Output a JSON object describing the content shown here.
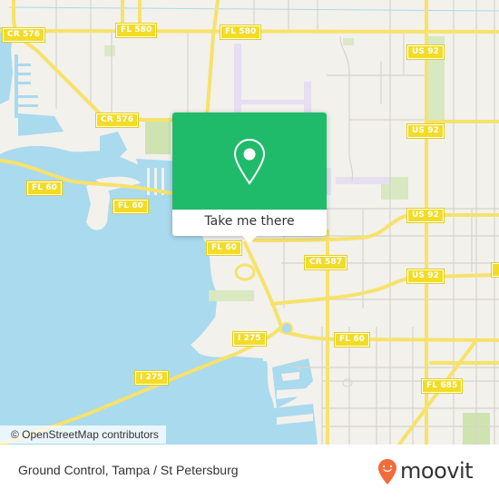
{
  "map": {
    "attribution": "© OpenStreetMap contributors",
    "colors": {
      "land": "#f2f1ec",
      "water": "#aadaee",
      "road_major": "#f7e26b",
      "road_minor": "#d6d4cc",
      "park": "#cfe3b0",
      "airport": "#e6dff2",
      "shield": "#f2dc27"
    },
    "road_labels": [
      {
        "id": "cr576-nw",
        "text": "CR 576"
      },
      {
        "id": "fl580-w",
        "text": "FL 580"
      },
      {
        "id": "fl580-e",
        "text": "FL 580"
      },
      {
        "id": "us92-n1",
        "text": "US 92"
      },
      {
        "id": "cr576-s",
        "text": "CR 576"
      },
      {
        "id": "us92-n2",
        "text": "US 92"
      },
      {
        "id": "fl60-w",
        "text": "FL 60"
      },
      {
        "id": "fl60-mid",
        "text": "FL 60"
      },
      {
        "id": "us92-mid",
        "text": "US 92"
      },
      {
        "id": "fl60-c",
        "text": "FL 60"
      },
      {
        "id": "cr587",
        "text": "CR 587"
      },
      {
        "id": "us92-s",
        "text": "US 92"
      },
      {
        "id": "i275-n",
        "text": "I 275"
      },
      {
        "id": "fl60-e",
        "text": "FL 60"
      },
      {
        "id": "i275-s",
        "text": "I 275"
      },
      {
        "id": "fl685",
        "text": "FL 685"
      }
    ]
  },
  "popup": {
    "icon": "map-pin-icon",
    "action_label": "Take me there",
    "accent": "#20bb6a"
  },
  "footer": {
    "place_title": "Ground Control, Tampa / St Petersburg",
    "brand": "moovit",
    "brand_color": "#f26b3a"
  }
}
